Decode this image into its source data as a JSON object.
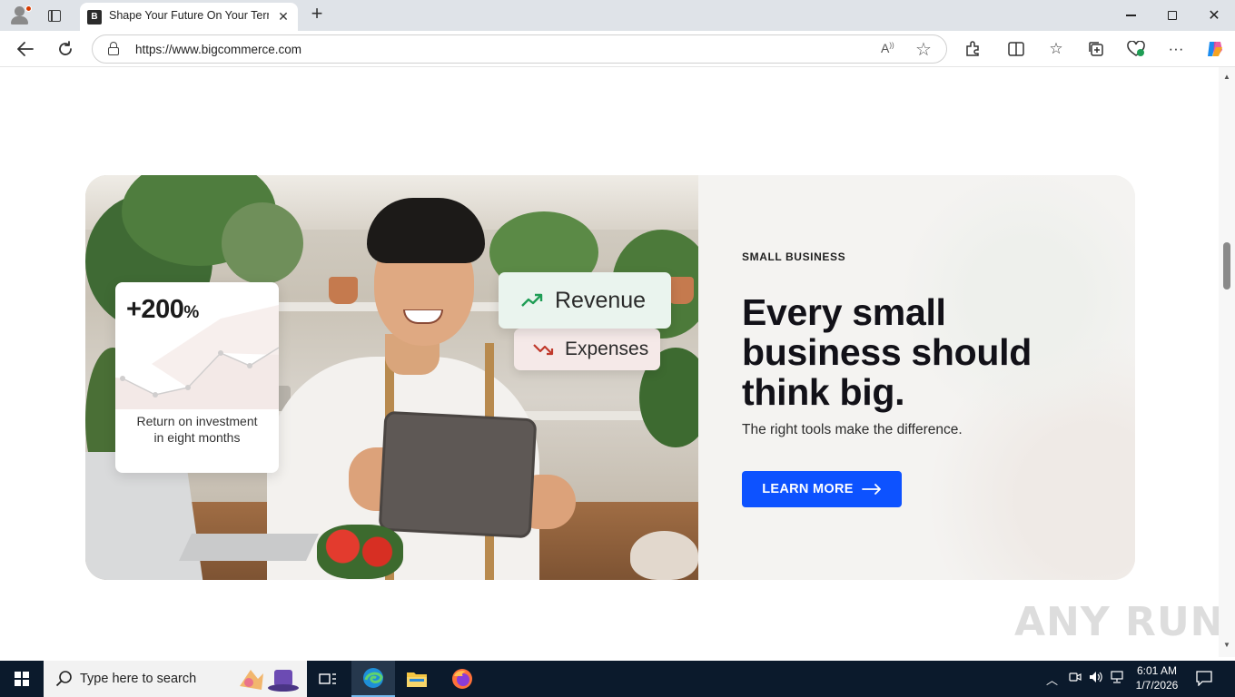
{
  "browser": {
    "tab_title": "Shape Your Future On Your Terms",
    "url": "https://www.bigcommerce.com",
    "new_tab": "+",
    "close": "✕"
  },
  "hero": {
    "roi_value": "+200",
    "roi_unit": "%",
    "roi_caption_line1": "Return on investment",
    "roi_caption_line2": "in eight months",
    "revenue_label": "Revenue",
    "expenses_label": "Expenses",
    "eyebrow": "SMALL BUSINESS",
    "headline_line1": "Every small",
    "headline_line2": "business should",
    "headline_line3": "think big.",
    "subtext": "The right tools make the difference.",
    "cta_label": "LEARN MORE"
  },
  "watermark": "ANY RUN",
  "taskbar": {
    "search_placeholder": "Type here to search",
    "time": "6:01 AM",
    "date": "1/7/2026"
  },
  "colors": {
    "cta": "#0d52ff",
    "revenue_trend": "#1f9d55",
    "expenses_trend": "#c0392b",
    "taskbar": "#0b1a2c"
  }
}
